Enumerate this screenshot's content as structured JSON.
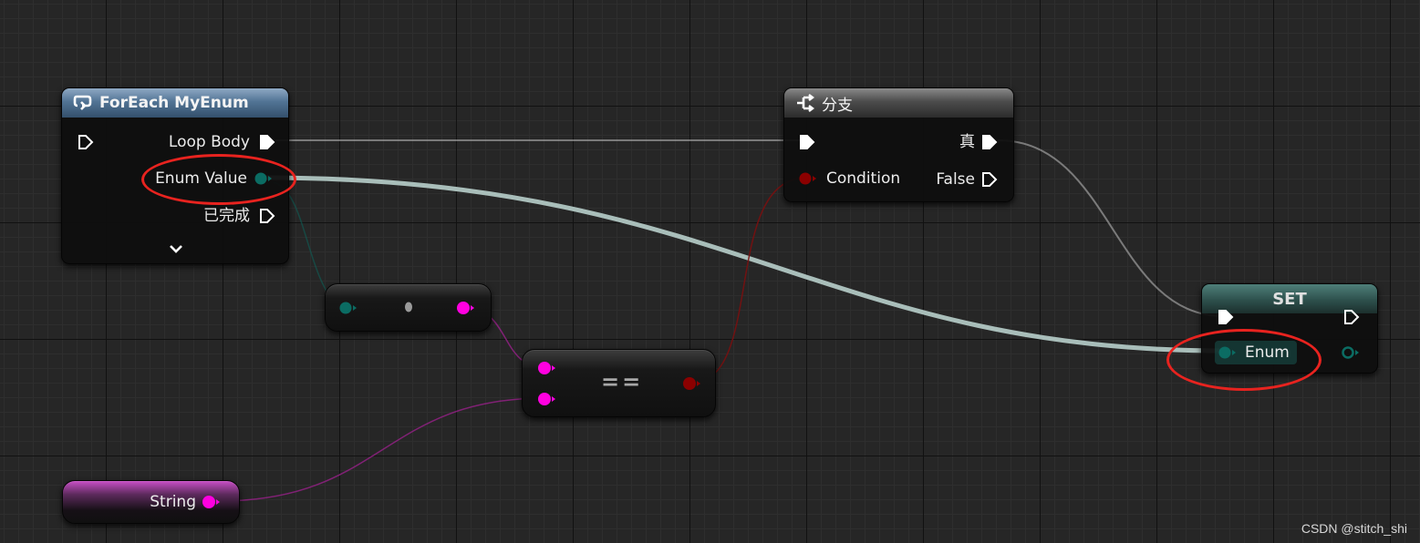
{
  "nodes": {
    "foreach": {
      "title": "ForEach MyEnum",
      "outputs": {
        "loop_body": "Loop Body",
        "enum_value": "Enum Value",
        "completed": "已完成"
      }
    },
    "branch": {
      "title": "分支",
      "inputs": {
        "condition": "Condition"
      },
      "outputs": {
        "true": "真",
        "false": "False"
      }
    },
    "set": {
      "title": "SET",
      "inputs": {
        "enum": "Enum"
      }
    },
    "equal": {
      "title": "=="
    },
    "string": {
      "label": "String"
    }
  },
  "pin_colors": {
    "exec": "#ffffff",
    "enum": "#0b6c63",
    "string": "#ff00e0",
    "boolean": "#8b0000"
  },
  "highlight_color": "#e8231f",
  "watermark": "CSDN @stitch_shi"
}
